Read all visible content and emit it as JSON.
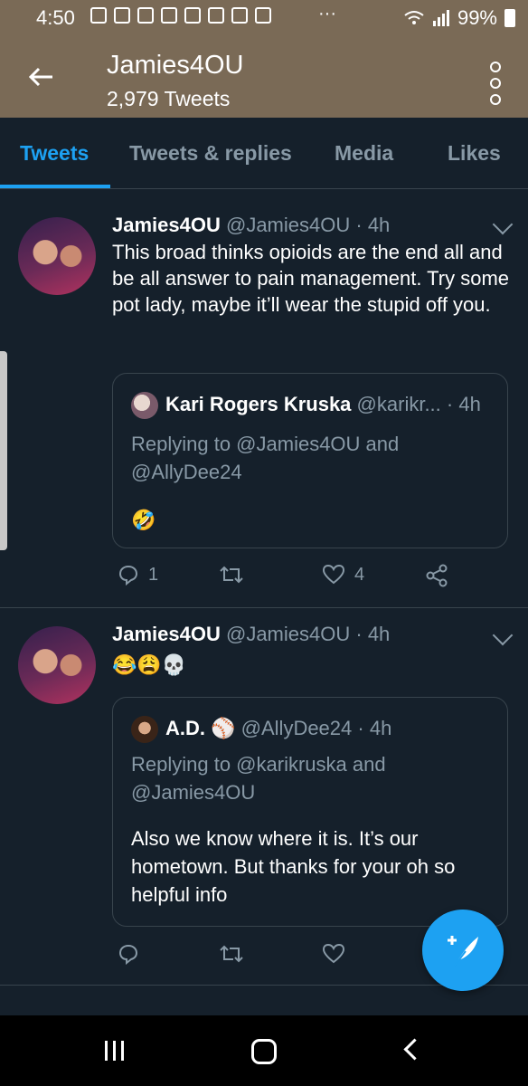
{
  "status_bar": {
    "time": "4:50",
    "overflow": "···",
    "battery": "99%"
  },
  "header": {
    "title": "Jamies4OU",
    "subtitle": "2,979 Tweets"
  },
  "tabs": [
    {
      "label": "Tweets",
      "active": true
    },
    {
      "label": "Tweets & replies",
      "active": false
    },
    {
      "label": "Media",
      "active": false
    },
    {
      "label": "Likes",
      "active": false
    }
  ],
  "tweets": [
    {
      "name": "Jamies4OU",
      "handle": "@Jamies4OU",
      "time": "· 4h",
      "text": "This broad thinks opioids are the end all and be all answer to pain management. Try some pot lady, maybe it’ll wear the stupid off you.",
      "quote": {
        "name": "Kari Rogers Kruska",
        "handle": "@karikr...",
        "time": "· 4h",
        "replying": "Replying to @Jamies4OU and @AllyDee24",
        "body": "🤣"
      },
      "actions": {
        "replies": "1",
        "likes": "4"
      }
    },
    {
      "name": "Jamies4OU",
      "handle": "@Jamies4OU",
      "time": "· 4h",
      "text": "😂😩💀",
      "quote": {
        "name": "A.D.",
        "badge": "⚾",
        "handle": "@AllyDee24",
        "time": "· 4h",
        "replying": "Replying to @karikruska and @Jamies4OU",
        "body": "Also we know where it is. It’s our hometown. But thanks for your oh so helpful info"
      }
    }
  ],
  "colors": {
    "accent": "#1da1f2",
    "background": "#15202b",
    "header_bg": "#7a6a56",
    "muted": "#8899a6"
  }
}
